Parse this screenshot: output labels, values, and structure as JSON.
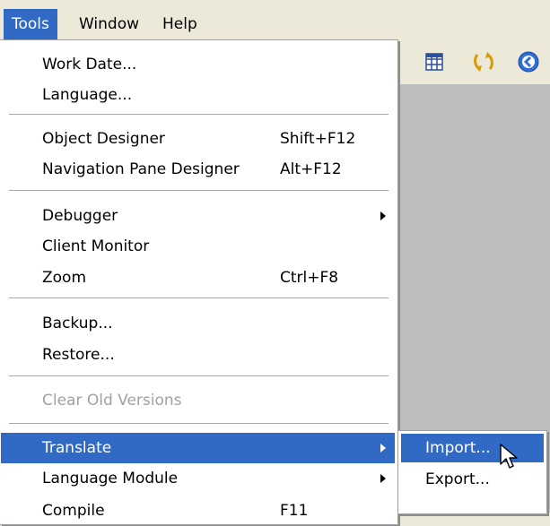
{
  "menubar": {
    "items": [
      {
        "label": "Tools"
      },
      {
        "label": "Window"
      },
      {
        "label": "Help"
      }
    ]
  },
  "toolbar": {
    "icons": [
      "grid-icon",
      "refresh-icon",
      "info-icon"
    ]
  },
  "tools_menu": {
    "items": [
      {
        "label": "Work Date...",
        "shortcut": ""
      },
      {
        "label": "Language...",
        "shortcut": ""
      },
      {
        "label": "Object Designer",
        "shortcut": "Shift+F12"
      },
      {
        "label": "Navigation Pane Designer",
        "shortcut": "Alt+F12"
      },
      {
        "label": "Debugger",
        "shortcut": ""
      },
      {
        "label": "Client Monitor",
        "shortcut": ""
      },
      {
        "label": "Zoom",
        "shortcut": "Ctrl+F8"
      },
      {
        "label": "Backup...",
        "shortcut": ""
      },
      {
        "label": "Restore...",
        "shortcut": ""
      },
      {
        "label": "Clear Old Versions",
        "shortcut": ""
      },
      {
        "label": "Translate",
        "shortcut": ""
      },
      {
        "label": "Language Module",
        "shortcut": ""
      },
      {
        "label": "Compile",
        "shortcut": "F11"
      }
    ]
  },
  "translate_submenu": {
    "items": [
      {
        "label": "Import..."
      },
      {
        "label": "Export..."
      }
    ]
  },
  "colors": {
    "highlight": "#316ac5",
    "menu_bg": "#ece9d8",
    "client_bg": "#bebebe",
    "disabled_text": "#a1a1a1"
  }
}
